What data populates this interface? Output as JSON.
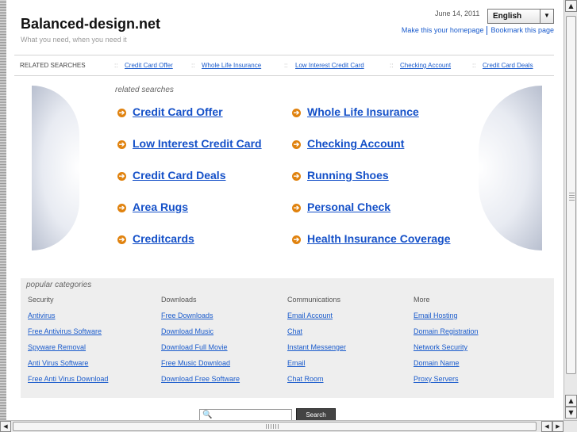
{
  "header": {
    "site_title": "Balanced-design.net",
    "tagline": "What you need, when you need it",
    "date": "June 14, 2011",
    "language": "English",
    "homepage_link": "Make this your homepage",
    "bookmark_link": "Bookmark this page"
  },
  "related_bar": {
    "label": "RELATED SEARCHES",
    "separator": "::",
    "links": [
      "Credit Card Offer",
      "Whole Life Insurance",
      "Low Interest Credit Card",
      "Checking Account",
      "Credit Card Deals"
    ]
  },
  "related": {
    "heading": "related searches",
    "left": [
      "Credit Card Offer",
      "Low Interest Credit Card",
      "Credit Card Deals",
      "Area Rugs",
      "Creditcards"
    ],
    "right": [
      "Whole Life Insurance",
      "Checking Account",
      "Running Shoes",
      "Personal Check",
      "Health Insurance Coverage"
    ]
  },
  "popular": {
    "heading": "popular categories",
    "columns": [
      {
        "title": "Security",
        "links": [
          "Antivirus",
          "Free Antivirus Software",
          "Spyware Removal",
          "Anti Virus Software",
          "Free Anti Virus Download"
        ]
      },
      {
        "title": "Downloads",
        "links": [
          "Free Downloads",
          "Download Music",
          "Download Full Movie",
          "Free Music Download",
          "Download Free Software"
        ]
      },
      {
        "title": "Communications",
        "links": [
          "Email Account",
          "Chat",
          "Instant Messenger",
          "Email",
          "Chat Room"
        ]
      },
      {
        "title": "More",
        "links": [
          "Email Hosting",
          "Domain Registration",
          "Network Security",
          "Domain Name",
          "Proxy Servers"
        ]
      }
    ]
  },
  "search": {
    "placeholder": "",
    "button": "Search"
  },
  "colors": {
    "link": "#1a5bcc",
    "bullet": "#e0820e",
    "panel": "#eeeeee"
  }
}
